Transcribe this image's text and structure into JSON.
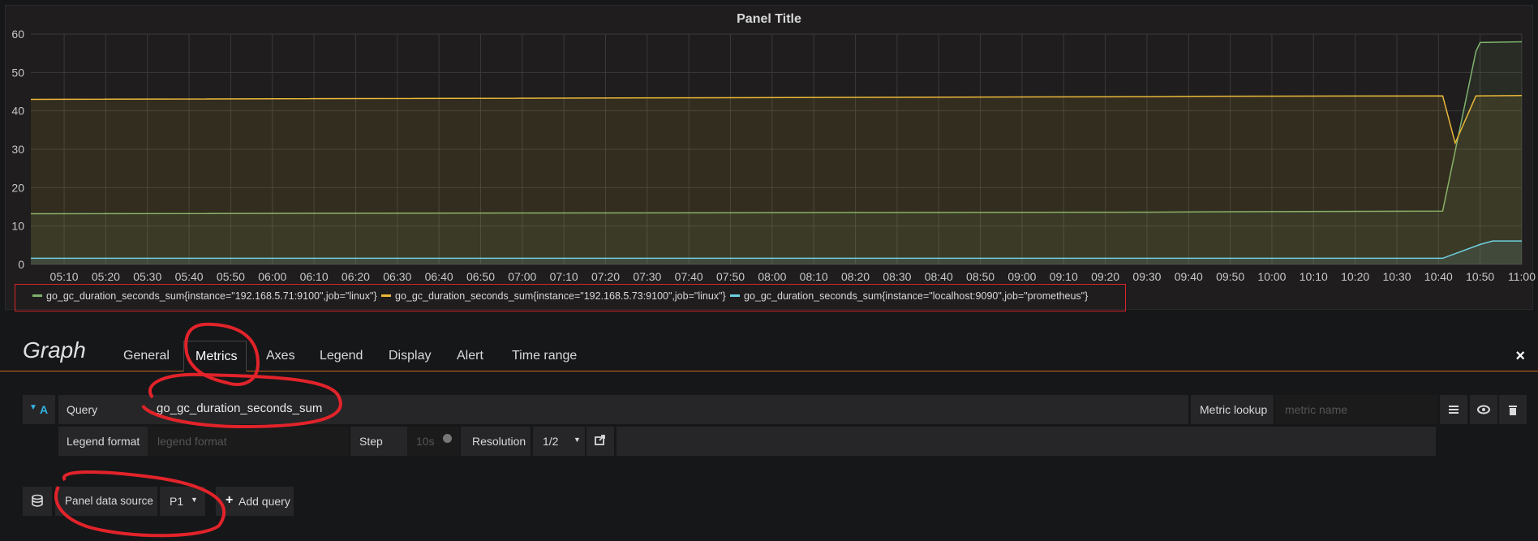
{
  "panel": {
    "title": "Panel Title",
    "legend": [
      {
        "label": "go_gc_duration_seconds_sum{instance=\"192.168.5.71:9100\",job=\"linux\"}",
        "color": "#7eb26d"
      },
      {
        "label": "go_gc_duration_seconds_sum{instance=\"192.168.5.73:9100\",job=\"linux\"}",
        "color": "#eab839"
      },
      {
        "label": "go_gc_duration_seconds_sum{instance=\"localhost:9090\",job=\"prometheus\"}",
        "color": "#6ed0e0"
      }
    ]
  },
  "chart_data": {
    "type": "line",
    "title": "Panel Title",
    "ylim": [
      0,
      60
    ],
    "yticks": [
      "0",
      "10",
      "20",
      "30",
      "40",
      "50",
      "60"
    ],
    "xticks": [
      "05:10",
      "05:20",
      "05:30",
      "05:40",
      "05:50",
      "06:00",
      "06:10",
      "06:20",
      "06:30",
      "06:40",
      "06:50",
      "07:00",
      "07:10",
      "07:20",
      "07:30",
      "07:40",
      "07:50",
      "08:00",
      "08:10",
      "08:20",
      "08:30",
      "08:40",
      "08:50",
      "09:00",
      "09:10",
      "09:20",
      "09:30",
      "09:40",
      "09:50",
      "10:00",
      "10:10",
      "10:20",
      "10:30",
      "10:40",
      "10:50",
      "11:00"
    ],
    "grid": true,
    "legend_position": "bottom",
    "series": [
      {
        "name": "go_gc_duration_seconds_sum{instance=\"192.168.5.71:9100\",job=\"linux\"}",
        "color": "#7eb26d",
        "points": [
          [
            "05:02",
            13.2
          ],
          [
            "09:30",
            13.6
          ],
          [
            "09:42",
            13.7
          ],
          [
            "10:41",
            13.9
          ],
          [
            "10:49",
            55.5
          ],
          [
            "10:50",
            57.8
          ],
          [
            "11:00",
            58.0
          ]
        ]
      },
      {
        "name": "go_gc_duration_seconds_sum{instance=\"192.168.5.73:9100\",job=\"linux\"}",
        "color": "#eab839",
        "points": [
          [
            "05:02",
            43.0
          ],
          [
            "09:30",
            43.7
          ],
          [
            "09:42",
            43.8
          ],
          [
            "10:41",
            43.9
          ],
          [
            "10:44",
            31.6
          ],
          [
            "10:49",
            43.9
          ],
          [
            "11:00",
            44.0
          ]
        ]
      },
      {
        "name": "go_gc_duration_seconds_sum{instance=\"localhost:9090\",job=\"prometheus\"}",
        "color": "#6ed0e0",
        "points": [
          [
            "05:02",
            1.6
          ],
          [
            "10:41",
            1.6
          ],
          [
            "10:50",
            5.2
          ],
          [
            "10:53",
            6.1
          ],
          [
            "11:00",
            6.1
          ]
        ]
      }
    ]
  },
  "editor": {
    "title": "Graph",
    "tabs": [
      "General",
      "Metrics",
      "Axes",
      "Legend",
      "Display",
      "Alert",
      "Time range"
    ],
    "close_icon": "×",
    "query_ref": "A",
    "query_label": "Query",
    "query_value": "go_gc_duration_seconds_sum",
    "metric_lookup_label": "Metric lookup",
    "metric_name_placeholder": "metric name",
    "legend_format_label": "Legend format",
    "legend_format_placeholder": "legend format",
    "step_label": "Step",
    "step_placeholder": "10s",
    "resolution_label": "Resolution",
    "resolution_value": "1/2",
    "datasource_label": "Panel data source",
    "datasource_value": "P1",
    "add_query_label": "Add query"
  }
}
